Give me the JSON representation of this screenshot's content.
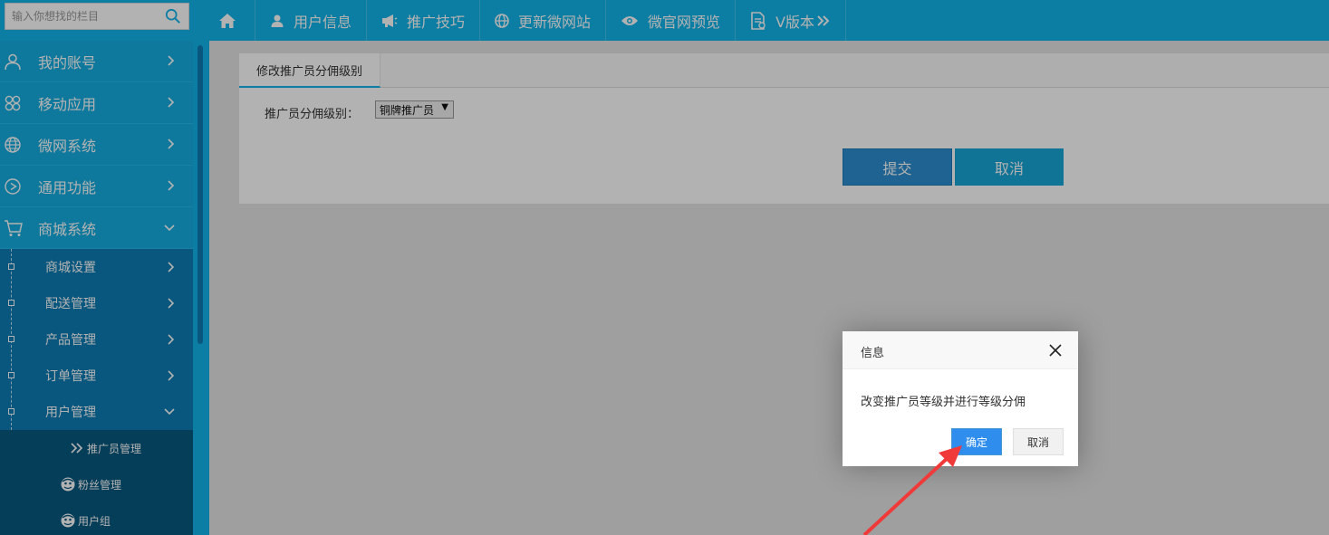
{
  "search": {
    "placeholder": "输入你想找的栏目"
  },
  "topnav": [
    {
      "label": "",
      "icon": "home-icon"
    },
    {
      "label": "用户信息",
      "icon": "user-icon"
    },
    {
      "label": "推广技巧",
      "icon": "megaphone-icon"
    },
    {
      "label": "更新微网站",
      "icon": "globe-icon"
    },
    {
      "label": "微官网预览",
      "icon": "eye-icon"
    },
    {
      "label": "V版本",
      "icon": "document-icon"
    }
  ],
  "sidebar": {
    "items": [
      {
        "label": "我的账号",
        "icon": "user-outline-icon"
      },
      {
        "label": "移动应用",
        "icon": "flower-icon"
      },
      {
        "label": "微网系统",
        "icon": "globe-icon"
      },
      {
        "label": "通用功能",
        "icon": "play-circle-icon"
      },
      {
        "label": "商城系统",
        "icon": "cart-icon"
      }
    ],
    "shop_sub": [
      {
        "label": "商城设置"
      },
      {
        "label": "配送管理"
      },
      {
        "label": "产品管理"
      },
      {
        "label": "订单管理"
      },
      {
        "label": "用户管理"
      }
    ],
    "user_sub": [
      {
        "label": "推广员管理"
      },
      {
        "label": "粉丝管理"
      },
      {
        "label": "用户组"
      }
    ]
  },
  "panel": {
    "tab": "修改推广员分佣级别",
    "field_label": "推广员分佣级别：",
    "select_value": "铜牌推广员",
    "submit": "提交",
    "cancel": "取消"
  },
  "dialog": {
    "title": "信息",
    "message": "改变推广员等级并进行等级分佣",
    "ok": "确定",
    "cancel": "取消"
  },
  "colors": {
    "topbar": "#13b5ea",
    "sidebar": "#13b5ea",
    "submenu": "#0d7db5",
    "accent_ok": "#2e8ded",
    "arrow": "#f03a3a"
  }
}
